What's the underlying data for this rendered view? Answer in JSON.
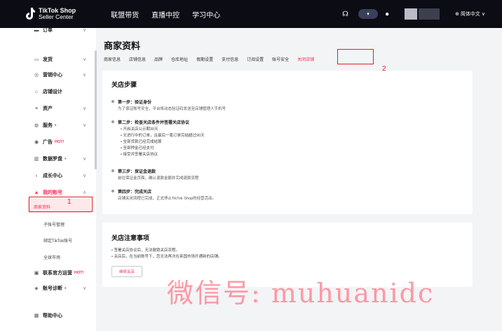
{
  "logo": {
    "line1": "TikTok Shop",
    "line2": "Seller Center"
  },
  "topnav": {
    "item1": "联盟带货",
    "item2": "直播中控",
    "item3": "学习中心"
  },
  "topright": {
    "headset": "☊",
    "msg": "▾",
    "bell": "🔔",
    "lang": "⊕ 简体中文 ∨"
  },
  "sidebar": {
    "items": [
      {
        "icon": "▬",
        "label": "订单",
        "chev": "∨"
      },
      {
        "icon": "▭",
        "label": "发货",
        "chev": "∨"
      },
      {
        "icon": "◎",
        "label": "营销中心",
        "chev": "∨"
      },
      {
        "icon": "⌂",
        "label": "店铺设计",
        "chev": ""
      },
      {
        "icon": "≡",
        "label": "资产",
        "chev": "∨"
      },
      {
        "icon": "◍",
        "label": "服务",
        "chev": "∨",
        "dot": "•"
      },
      {
        "icon": "◉",
        "label": "广告",
        "chev": "",
        "hot": "HOT!"
      },
      {
        "icon": "▥",
        "label": "数据罗盘",
        "chev": "∨",
        "dot": "•"
      },
      {
        "icon": "♁",
        "label": "成长中心",
        "chev": "∨"
      },
      {
        "icon": "▲",
        "label": "我的账号",
        "chev": "∧"
      }
    ],
    "subs": {
      "store_info": "商家资料",
      "sub_accounts": "子账号管理",
      "bind_tiktok": "绑定TikTok账号",
      "global_market": "全球市场"
    },
    "bottom": [
      {
        "icon": "▣",
        "label": "联系官方运营",
        "hot": "HOT!"
      },
      {
        "icon": "◈",
        "label": "账号诊断",
        "dot": "•",
        "chev": "∨"
      },
      {
        "icon": "▦",
        "label": "帮助中心"
      }
    ]
  },
  "annotations": {
    "one": "1",
    "two": "2"
  },
  "page": {
    "title": "商家资料",
    "tabs": [
      "商家信息",
      "店铺信息",
      "品牌",
      "仓库地址",
      "假期设置",
      "支付信息",
      "订阅设置",
      "账号安全",
      "关闭店铺"
    ]
  },
  "close_steps": {
    "title": "关店步骤",
    "step1": {
      "title": "第一步：验证身份",
      "desc": "为了保证账号安全，平台将动态验证码发送至店铺管理人手机号"
    },
    "step2": {
      "title": "第二步：检查关店条件并签署关店协议",
      "bullets": [
        "开启关店公示期30天",
        "无进行中的订单，且最后一笔订单完结超过90天",
        "全部货款已经完成结算",
        "全部押金已经支付",
        "接受并签署关店协议"
      ]
    },
    "step3": {
      "title": "第三步：保证金退款",
      "desc": "前往保证金页面，确认退款金额并完成退款流程"
    },
    "step4": {
      "title": "第四步：完成关店",
      "desc": "店铺关闭流程已完成，正式停止TikTok Shop的经营活动。"
    }
  },
  "notes": {
    "title": "关店注意事项",
    "bullets": [
      "签署关店协议后，无法撤销关店流程。",
      "关店后，在当前账号下，您无法再次在英国市场开通新的店铺。"
    ],
    "button": "继续关店"
  },
  "watermark": "微信号: muhuanidc",
  "colors": {
    "accent": "#fe2c55",
    "topbar": "#0c0c14",
    "annotation": "#e02020"
  }
}
